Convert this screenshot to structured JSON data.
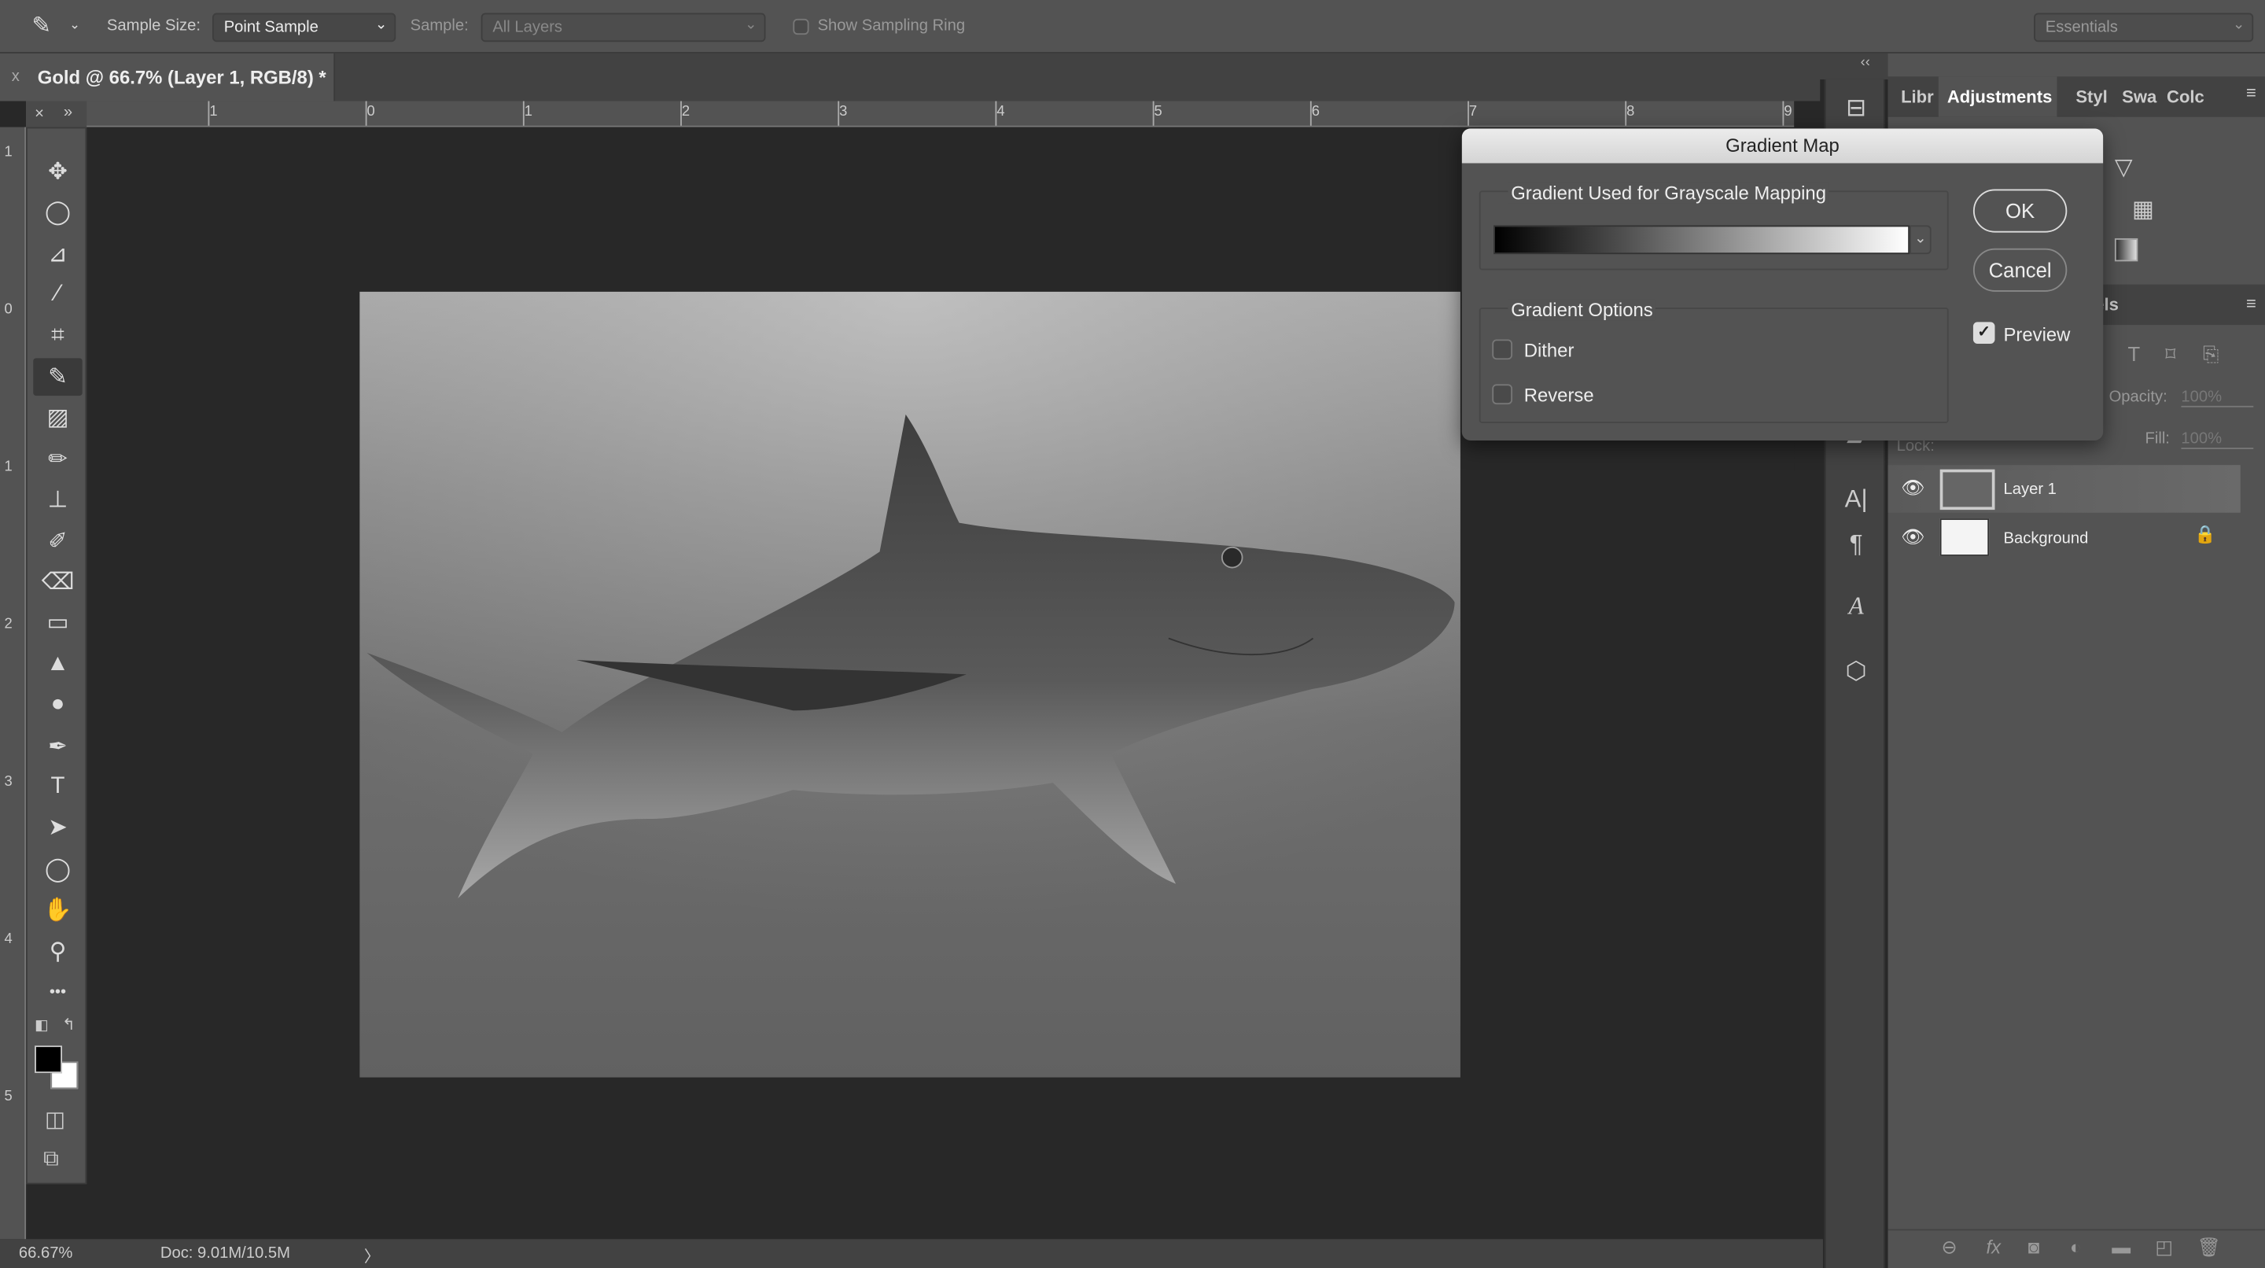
{
  "options_bar": {
    "tool_icon": "eyedropper-icon",
    "sample_size_label": "Sample Size:",
    "sample_size_value": "Point Sample",
    "sample_label": "Sample:",
    "sample_value": "All Layers",
    "show_ring_label": "Show Sampling Ring",
    "show_ring_checked": false,
    "workspace": "Essentials"
  },
  "document": {
    "tab_title": "Gold @ 66.7% (Layer 1, RGB/8) *",
    "close": "x"
  },
  "rulers": {
    "horizontal": [
      "1",
      "0",
      "1",
      "2",
      "3",
      "4",
      "5",
      "6",
      "7",
      "8",
      "9"
    ],
    "vertical": [
      "1",
      "0",
      "1",
      "2",
      "3",
      "4",
      "5"
    ]
  },
  "tools": [
    "move",
    "elliptical-marquee",
    "polygonal-lasso",
    "magic-wand",
    "crop",
    "eyedropper",
    "healing-brush",
    "brush",
    "clone-stamp",
    "history-brush",
    "eraser",
    "gradient",
    "blur",
    "dodge",
    "pen",
    "type",
    "path-selection",
    "ellipse",
    "hand",
    "zoom",
    "more"
  ],
  "tools_glyphs": [
    "✥",
    "◯",
    "⊿",
    "⁄",
    "⌗",
    "✎",
    "▨",
    "✏",
    "⊥",
    "✐",
    "⌫",
    "▭",
    "▲",
    "●",
    "✒",
    "T",
    "➤",
    "◯",
    "✋",
    "⚲",
    "•••"
  ],
  "status": {
    "zoom": "66.67%",
    "doc": "Doc: 9.01M/10.5M",
    "arrow": "〉"
  },
  "panels": {
    "tabs": [
      "Libr",
      "Adjustments",
      "Styl",
      "Swa",
      "Colc"
    ],
    "active_tab": "Adjustments",
    "layers_tab_partial": "els",
    "opacity_label": "Opacity:",
    "opacity_value": "100%",
    "fill_label": "Fill:",
    "fill_value": "100%",
    "lock_label": "Lock:"
  },
  "layers": [
    {
      "name": "Layer 1",
      "visible": true,
      "selected": true
    },
    {
      "name": "Background",
      "visible": true,
      "locked": true
    }
  ],
  "dialog": {
    "title": "Gradient Map",
    "group1": "Gradient Used for Grayscale Mapping",
    "group2": "Gradient Options",
    "dither": "Dither",
    "dither_checked": false,
    "reverse": "Reverse",
    "reverse_checked": false,
    "ok": "OK",
    "cancel": "Cancel",
    "preview": "Preview",
    "preview_checked": true
  }
}
